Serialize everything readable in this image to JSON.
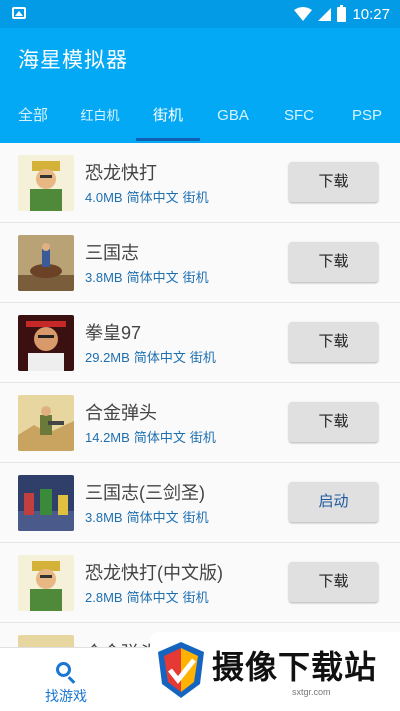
{
  "status_bar": {
    "time": "10:27"
  },
  "app_bar": {
    "title": "海星模拟器"
  },
  "tabs": [
    {
      "label": "全部"
    },
    {
      "label": "红白机"
    },
    {
      "label": "街机"
    },
    {
      "label": "GBA"
    },
    {
      "label": "SFC"
    },
    {
      "label": "PSP"
    }
  ],
  "active_tab": "街机",
  "games": [
    {
      "title": "恐龙快打",
      "size": "4.0MB",
      "language": "简体中文",
      "platform": "街机",
      "action": "下载",
      "thumb": "dino-soldier-icon"
    },
    {
      "title": "三国志",
      "size": "3.8MB",
      "language": "简体中文",
      "platform": "街机",
      "action": "下载",
      "thumb": "horse-rider-icon"
    },
    {
      "title": "拳皇97",
      "size": "29.2MB",
      "language": "简体中文",
      "platform": "街机",
      "action": "下载",
      "thumb": "fighter-icon"
    },
    {
      "title": "合金弹头",
      "size": "14.2MB",
      "language": "简体中文",
      "platform": "街机",
      "action": "下载",
      "thumb": "soldier-icon"
    },
    {
      "title": "三国志(三剑圣)",
      "size": "3.8MB",
      "language": "简体中文",
      "platform": "街机",
      "action": "启动",
      "thumb": "battle-scene-icon"
    },
    {
      "title": "恐龙快打(中文版)",
      "size": "2.8MB",
      "language": "简体中文",
      "platform": "街机",
      "action": "下载",
      "thumb": "dino-soldier-icon"
    },
    {
      "title": "合金弹头",
      "size": "",
      "language": "",
      "platform": "",
      "action": "",
      "thumb": "soldier-icon"
    }
  ],
  "bottom_nav": {
    "find_label": "找游戏",
    "find_icon": "search-icon"
  },
  "watermark": {
    "text": "摄像下载站",
    "sub": "sxtgr.com"
  },
  "colors": {
    "status_bar": "#039be5",
    "app_bar": "#03a9f4",
    "meta_text": "#1e6fb0",
    "button": "#e0e0e0",
    "nav_active": "#1976d2"
  }
}
